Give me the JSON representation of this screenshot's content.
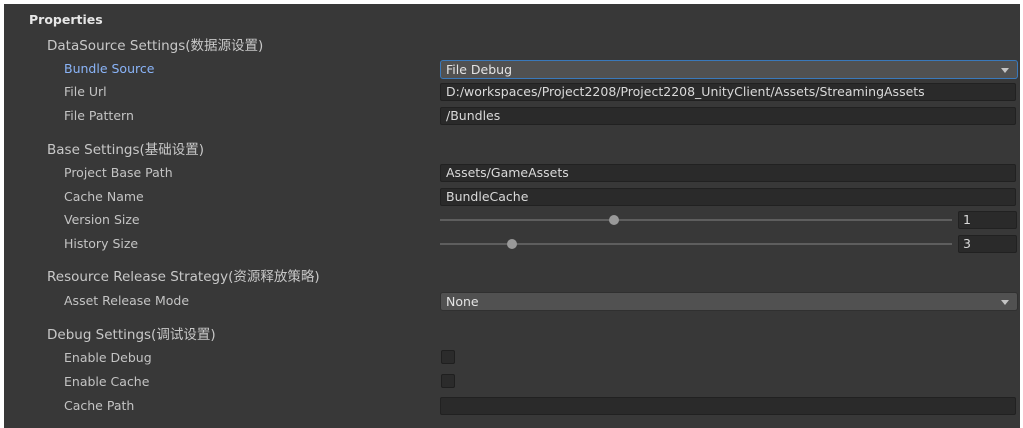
{
  "panel": {
    "title": "Properties"
  },
  "sections": {
    "datasource": {
      "title": "DataSource Settings(数据源设置)",
      "bundle_source": {
        "label": "Bundle Source",
        "value": "File Debug"
      },
      "file_url": {
        "label": "File Url",
        "value": "D:/workspaces/Project2208/Project2208_UnityClient/Assets/StreamingAssets"
      },
      "file_pattern": {
        "label": "File Pattern",
        "value": "/Bundles"
      }
    },
    "base": {
      "title": "Base Settings(基础设置)",
      "project_base_path": {
        "label": "Project Base Path",
        "value": "Assets/GameAssets"
      },
      "cache_name": {
        "label": "Cache Name",
        "value": "BundleCache"
      },
      "version_size": {
        "label": "Version Size",
        "value": "1",
        "slider_fraction": 0.34
      },
      "history_size": {
        "label": "History Size",
        "value": "3",
        "slider_fraction": 0.14
      }
    },
    "release": {
      "title": "Resource Release Strategy(资源释放策略)",
      "asset_release_mode": {
        "label": "Asset Release Mode",
        "value": "None"
      }
    },
    "debug": {
      "title": "Debug Settings(调试设置)",
      "enable_debug": {
        "label": "Enable Debug",
        "checked": false
      },
      "enable_cache": {
        "label": "Enable Cache",
        "checked": false
      },
      "cache_path": {
        "label": "Cache Path",
        "value": ""
      }
    }
  },
  "colors": {
    "panel_bg": "#383838",
    "active_label": "#8ab4f8",
    "focus_border": "#3a79bb",
    "dropdown_bg": "#515151",
    "field_bg": "#2a2a2a"
  },
  "icons": {
    "dropdown": "chevron-down-icon"
  }
}
